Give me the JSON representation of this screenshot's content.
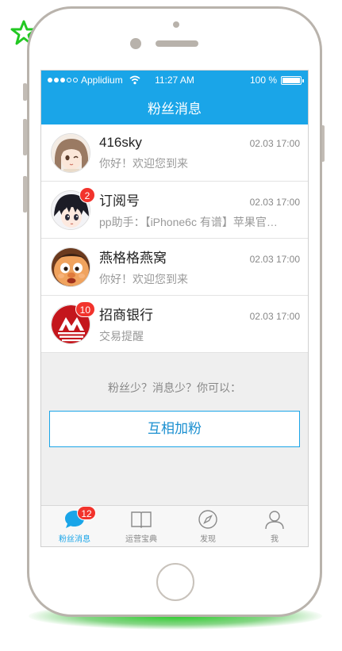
{
  "status_bar": {
    "carrier": "Applidium",
    "time": "11:27 AM",
    "battery": "100 %"
  },
  "nav": {
    "title": "粉丝消息"
  },
  "messages": [
    {
      "name": "416sky",
      "time": "02.03 17:00",
      "preview": "你好！欢迎您到来",
      "badge": "",
      "avatar_icon": "anime-girl-avatar"
    },
    {
      "name": "订阅号",
      "time": "02.03 17:00",
      "preview": "pp助手：【iPhone6c 有谱】苹果官…",
      "badge": "2",
      "avatar_icon": "anime-boy-avatar"
    },
    {
      "name": "燕格格燕窝",
      "time": "02.03 17:00",
      "preview": "你好！欢迎您到来",
      "badge": "",
      "avatar_icon": "cartoon-face-avatar"
    },
    {
      "name": "招商银行",
      "time": "02.03 17:00",
      "preview": "交易提醒",
      "badge": "10",
      "avatar_icon": "bank-logo-avatar"
    }
  ],
  "empty_prompt": "粉丝少？消息少？你可以：",
  "add_fans_button": "互相加粉",
  "tabs": [
    {
      "label": "粉丝消息",
      "badge": "12",
      "icon": "chat-bubble-icon",
      "active": true
    },
    {
      "label": "运营宝典",
      "badge": "",
      "icon": "book-icon",
      "active": false
    },
    {
      "label": "发现",
      "badge": "",
      "icon": "compass-icon",
      "active": false
    },
    {
      "label": "我",
      "badge": "",
      "icon": "person-icon",
      "active": false
    }
  ],
  "colors": {
    "accent": "#1aa5e8",
    "badge": "#f2332c",
    "glow": "#22c822"
  }
}
